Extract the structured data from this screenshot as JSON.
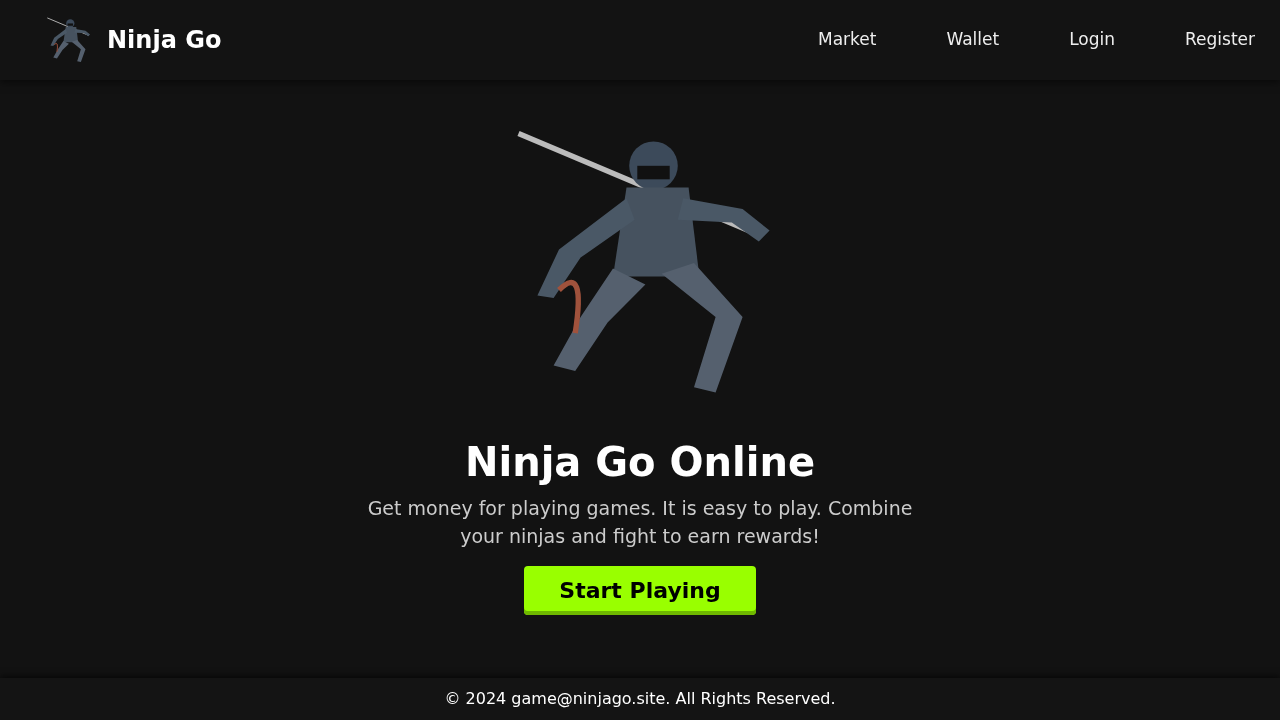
{
  "navbar": {
    "brand": "Ninja Go",
    "links": [
      {
        "label": "Market"
      },
      {
        "label": "Wallet"
      },
      {
        "label": "Login"
      },
      {
        "label": "Register"
      }
    ]
  },
  "hero": {
    "title": "Ninja Go Online",
    "text": "Get money for playing games. It is easy to play. Combine your ninjas and fight to earn rewards!",
    "button": "Start Playing"
  },
  "footer": {
    "text": "© 2024 game@ninjago.site. All Rights Reserved."
  }
}
